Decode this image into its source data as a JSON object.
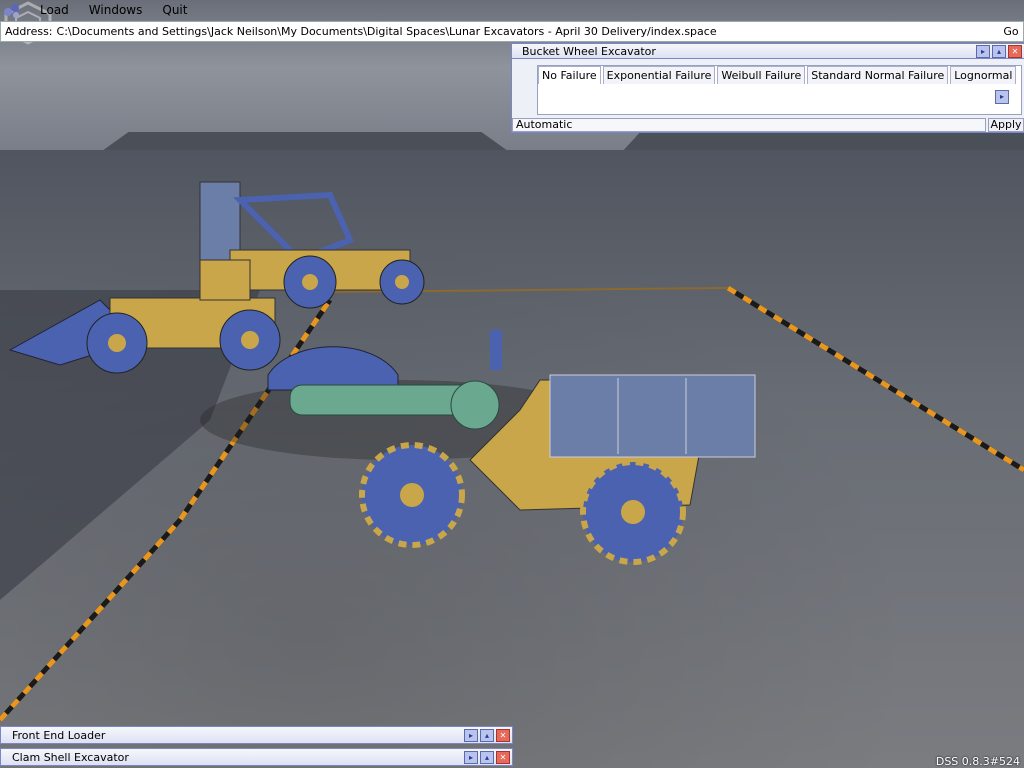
{
  "menubar": {
    "items": [
      {
        "label": "Load"
      },
      {
        "label": "Windows"
      },
      {
        "label": "Quit"
      }
    ]
  },
  "address": {
    "label": "Address:",
    "value": "C:\\Documents and Settings\\Jack Neilson\\My Documents\\Digital Spaces\\Lunar Excavators - April 30 Delivery/index.space",
    "go_label": "Go"
  },
  "panel": {
    "title": "Bucket Wheel Excavator",
    "tabs": [
      {
        "label": "No Failure",
        "active": true
      },
      {
        "label": "Exponential Failure"
      },
      {
        "label": "Weibull Failure"
      },
      {
        "label": "Standard Normal Failure"
      },
      {
        "label": "Lognormal"
      }
    ],
    "mode": "Automatic",
    "apply_label": "Apply"
  },
  "minimized_windows": [
    {
      "title": "Front End Loader"
    },
    {
      "title": "Clam Shell Excavator"
    }
  ],
  "version": "DSS 0.8.3#524",
  "colors": {
    "vehicle_body": "#c9a64a",
    "vehicle_parts": "#4a62b0",
    "bucket_wheel": "#6aa890",
    "panel_border": "#7a86c8",
    "barrier_orange": "#e8961e"
  }
}
